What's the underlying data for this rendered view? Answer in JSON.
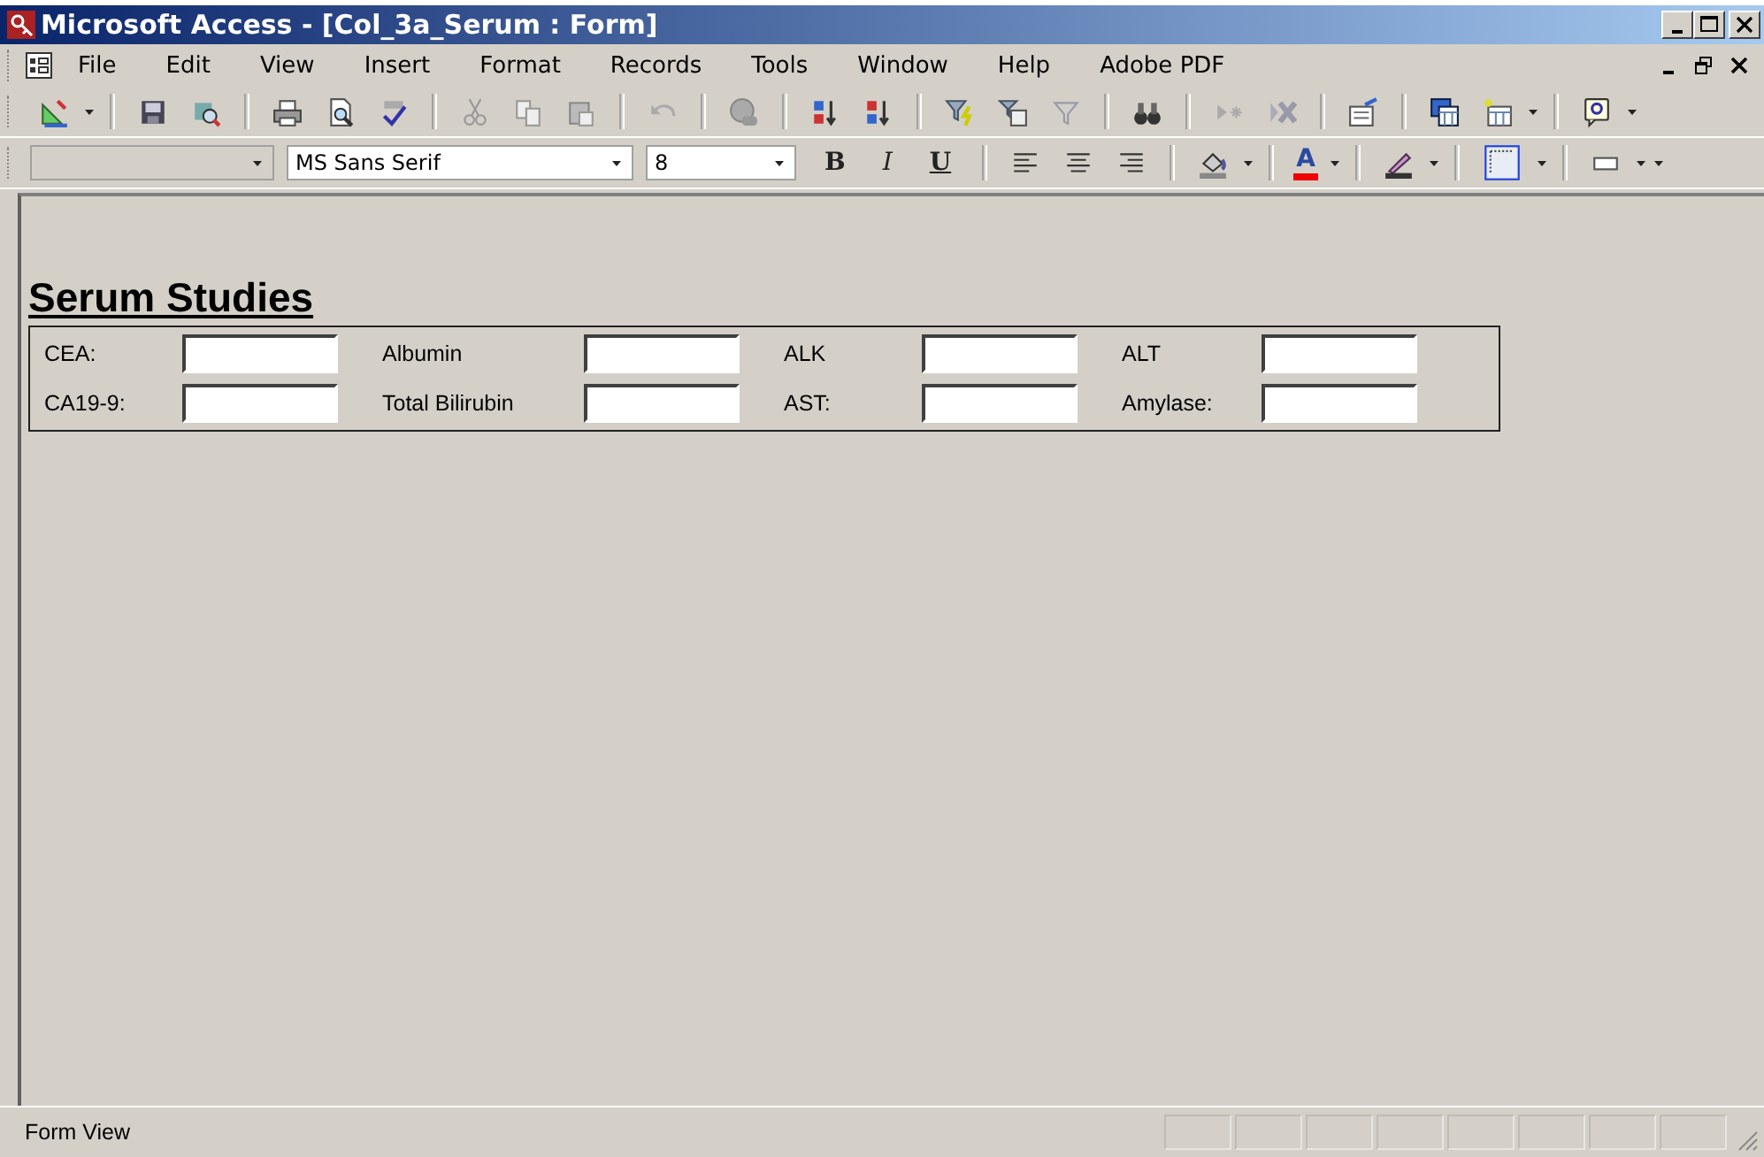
{
  "window": {
    "title": "Microsoft Access - [Col_3a_Serum : Form]"
  },
  "menu": [
    {
      "label": "File"
    },
    {
      "label": "Edit"
    },
    {
      "label": "View"
    },
    {
      "label": "Insert"
    },
    {
      "label": "Format"
    },
    {
      "label": "Records"
    },
    {
      "label": "Tools"
    },
    {
      "label": "Window"
    },
    {
      "label": "Help"
    },
    {
      "label": "Adobe PDF"
    }
  ],
  "formatting": {
    "font": "MS Sans Serif",
    "size": "8",
    "bold": "B",
    "italic": "I",
    "underline": "U",
    "font_color": "A"
  },
  "form": {
    "title": "Serum Studies",
    "rows": [
      [
        {
          "label": "CEA:"
        },
        {
          "label": "Albumin"
        },
        {
          "label": "ALK"
        },
        {
          "label": "ALT"
        }
      ],
      [
        {
          "label": "CA19-9:"
        },
        {
          "label": "Total Bilirubin"
        },
        {
          "label": "AST:"
        },
        {
          "label": "Amylase:"
        }
      ]
    ]
  },
  "status_bar": {
    "text": "Form View"
  }
}
